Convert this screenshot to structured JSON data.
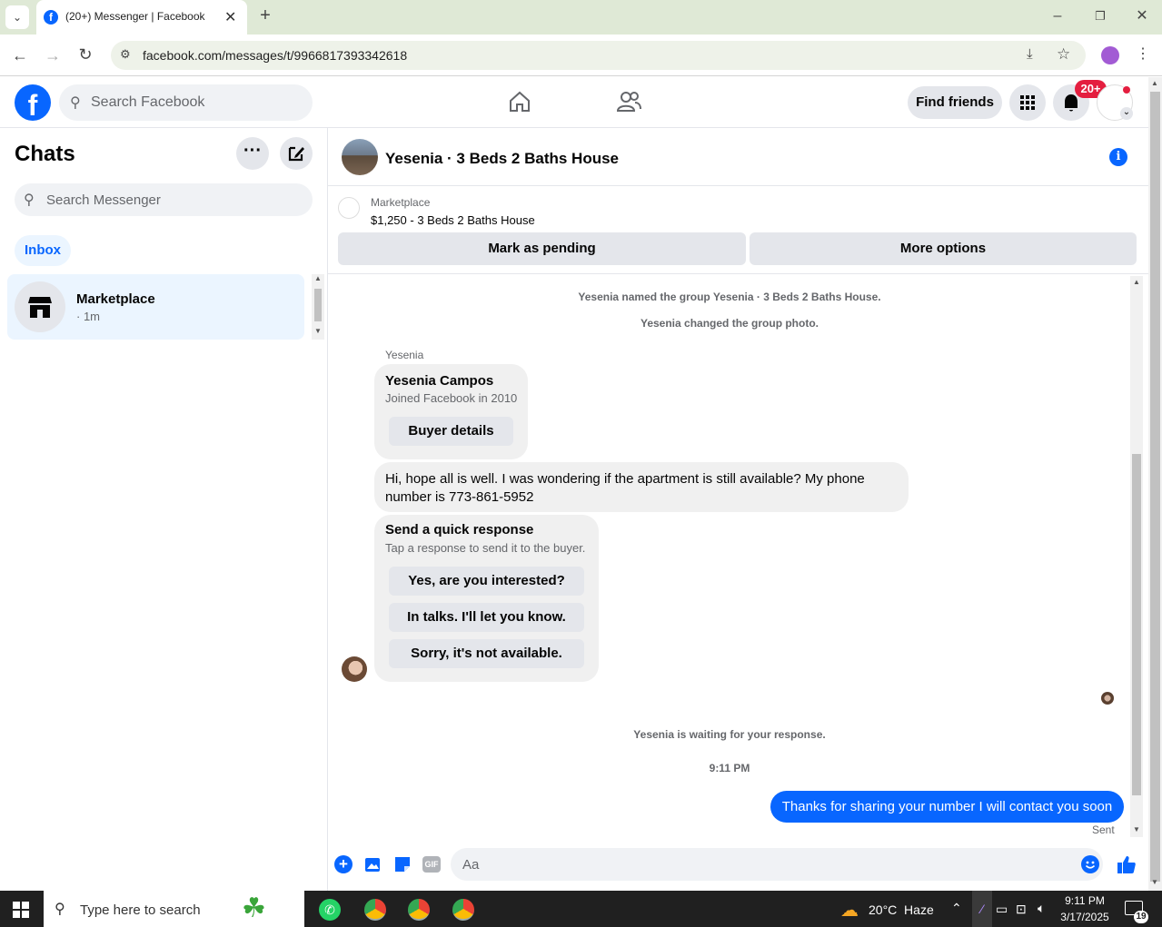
{
  "browser": {
    "tab_title": "(20+) Messenger | Facebook",
    "url": "facebook.com/messages/t/9966817393342618"
  },
  "fb": {
    "search_placeholder": "Search Facebook",
    "find_friends": "Find friends",
    "notif_badge": "20+"
  },
  "sidebar": {
    "title": "Chats",
    "search_placeholder": "Search Messenger",
    "inbox_tab": "Inbox",
    "chats": [
      {
        "name": "Marketplace",
        "time": "· 1m"
      }
    ]
  },
  "chat": {
    "title": "Yesenia · 3 Beds 2 Baths House",
    "listing": {
      "source": "Marketplace",
      "summary": "$1,250 - 3 Beds 2 Baths House",
      "mark_pending": "Mark as pending",
      "more_options": "More options"
    },
    "system_messages": [
      "Yesenia named the group Yesenia · 3 Beds 2 Baths House.",
      "Yesenia changed the group photo."
    ],
    "sender_name": "Yesenia",
    "profile_card": {
      "name": "Yesenia Campos",
      "joined": "Joined Facebook in 2010",
      "button": "Buyer details"
    },
    "incoming_message": "Hi, hope all is well. I was wondering if the apartment is still available? My phone number is 773-861-5952",
    "quick_response": {
      "title": "Send a quick response",
      "subtitle": "Tap a response to send it to the buyer.",
      "options": [
        "Yes, are you interested?",
        "In talks. I'll let you know.",
        "Sorry, it's not available."
      ]
    },
    "waiting": "Yesenia is waiting for your response.",
    "timestamp": "9:11 PM",
    "outgoing_message": "Thanks for sharing your number I will contact you soon",
    "sent_status": "Sent",
    "composer_placeholder": "Aa"
  },
  "taskbar": {
    "search_placeholder": "Type here to search",
    "weather": "20°C  Haze",
    "time": "9:11 PM",
    "date": "3/17/2025",
    "notif_count": "19"
  },
  "colors": {
    "fb_blue": "#0866ff",
    "bubble_gray": "#f0f0f0",
    "badge_red": "#e41e3f"
  }
}
